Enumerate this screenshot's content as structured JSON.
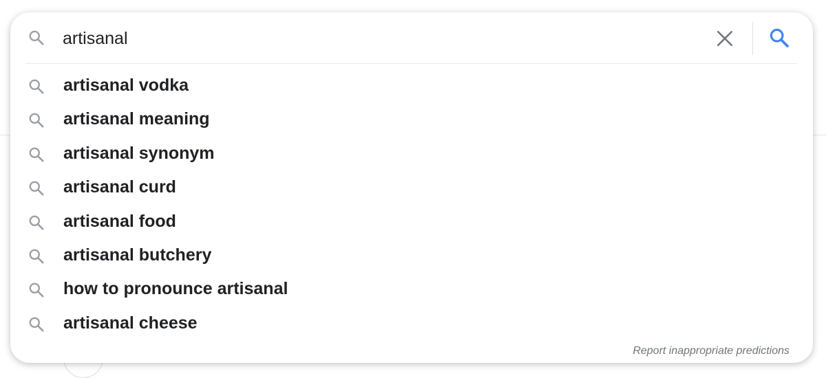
{
  "search": {
    "query": "artisanal"
  },
  "suggestions": [
    {
      "text": "artisanal vodka"
    },
    {
      "text": "artisanal meaning"
    },
    {
      "text": "artisanal synonym"
    },
    {
      "text": "artisanal curd"
    },
    {
      "text": "artisanal food"
    },
    {
      "text": "artisanal butchery"
    },
    {
      "text": "how to pronounce artisanal"
    },
    {
      "text": "artisanal cheese"
    }
  ],
  "footer": {
    "report_label": "Report inappropriate predictions"
  },
  "icons": {
    "suggestion_icon": "search-icon",
    "clear_icon": "close-icon",
    "submit_icon": "search-icon"
  },
  "colors": {
    "accent_blue": "#4285f4",
    "icon_gray": "#9aa0a6",
    "text": "#202124",
    "muted_text": "#70757a"
  }
}
